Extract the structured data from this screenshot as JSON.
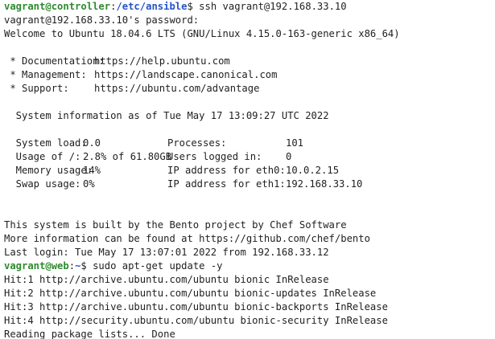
{
  "prompt1": {
    "user_host": "vagrant@controller",
    "sep": ":",
    "path": "/etc/ansible",
    "symbol": "$ ",
    "command": "ssh vagrant@192.168.33.10"
  },
  "password_prompt": "vagrant@192.168.33.10's password:",
  "welcome": "Welcome to Ubuntu 18.04.6 LTS (GNU/Linux 4.15.0-163-generic x86_64)",
  "links": [
    {
      "label": " * Documentation:",
      "url": "https://help.ubuntu.com"
    },
    {
      "label": " * Management:",
      "url": "https://landscape.canonical.com"
    },
    {
      "label": " * Support:",
      "url": "https://ubuntu.com/advantage"
    }
  ],
  "sysinfo_header": "  System information as of Tue May 17 13:09:27 UTC 2022",
  "stats": [
    {
      "label": "  System load:",
      "value": "0.0",
      "label2": "Processes:",
      "value2": "101"
    },
    {
      "label": "  Usage of /:",
      "value": "2.8% of 61.80GB",
      "label2": "Users logged in:",
      "value2": "0"
    },
    {
      "label": "  Memory usage:",
      "value": "14%",
      "label2": "IP address for eth0:",
      "value2": "10.0.2.15"
    },
    {
      "label": "  Swap usage:",
      "value": "0%",
      "label2": "IP address for eth1:",
      "value2": "192.168.33.10"
    }
  ],
  "bento_line1": "This system is built by the Bento project by Chef Software",
  "bento_line2": "More information can be found at https://github.com/chef/bento",
  "last_login": "Last login: Tue May 17 13:07:01 2022 from 192.168.33.12",
  "prompt2": {
    "user_host": "vagrant@web",
    "sep": ":",
    "path": "~",
    "symbol": "$ ",
    "command": "sudo apt-get update -y"
  },
  "apt_output": [
    "Hit:1 http://archive.ubuntu.com/ubuntu bionic InRelease",
    "Hit:2 http://archive.ubuntu.com/ubuntu bionic-updates InRelease",
    "Hit:3 http://archive.ubuntu.com/ubuntu bionic-backports InRelease",
    "Hit:4 http://security.ubuntu.com/ubuntu bionic-security InRelease",
    "Reading package lists... Done"
  ],
  "colors": {
    "prompt_user": "#2e8b2e",
    "prompt_path": "#2455c8",
    "text": "#1f1f1f",
    "background": "#ffffff"
  }
}
